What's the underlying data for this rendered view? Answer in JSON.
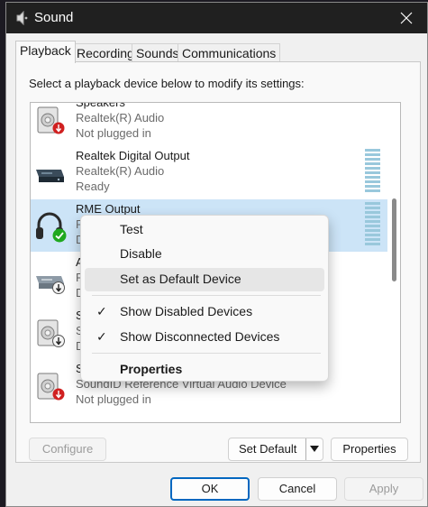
{
  "window": {
    "title": "Sound"
  },
  "tabs": [
    {
      "label": "Playback",
      "active": true
    },
    {
      "label": "Recording"
    },
    {
      "label": "Sounds"
    },
    {
      "label": "Communications"
    }
  ],
  "instruction": "Select a playback device below to modify its settings:",
  "devices": [
    {
      "name": "Speakers",
      "sub": "Realtek(R) Audio",
      "status": "Not plugged in",
      "icon": "speaker-icon",
      "badge": "unplugged-badge-icon"
    },
    {
      "name": "Realtek Digital Output",
      "sub": "Realtek(R) Audio",
      "status": "Ready",
      "icon": "digital-output-icon"
    },
    {
      "name": "RME Output",
      "sub": "R",
      "status": "D",
      "icon": "headphones-icon",
      "badge": "default-check-badge-icon",
      "selected": true
    },
    {
      "name": "A",
      "sub": "R",
      "status": "D",
      "icon": "digital-output-icon",
      "badge": "disabled-badge-icon"
    },
    {
      "name": "S",
      "sub": "S",
      "status": "D",
      "icon": "speaker-icon",
      "badge": "disabled-badge-icon"
    },
    {
      "name": "S",
      "sub": "SoundID Reference Virtual Audio Device",
      "status": "Not plugged in",
      "icon": "speaker-icon",
      "badge": "unplugged-badge-icon"
    }
  ],
  "context_menu": {
    "items": [
      {
        "label": "Test"
      },
      {
        "label": "Disable"
      },
      {
        "label": "Set as Default Device",
        "highlighted": true
      },
      {
        "label": "Show Disabled Devices",
        "checked": true,
        "check_glyph": "✓"
      },
      {
        "label": "Show Disconnected Devices",
        "checked": true,
        "check_glyph": "✓"
      },
      {
        "label": "Properties",
        "bold": true
      }
    ]
  },
  "buttons": {
    "configure": "Configure",
    "set_default": "Set Default",
    "properties": "Properties",
    "ok": "OK",
    "cancel": "Cancel",
    "apply": "Apply"
  },
  "colors": {
    "titlebar": "#202020",
    "selection": "#cce4f7",
    "accent": "#0067c0",
    "level_meter": "#99c8dc",
    "default_badge": "#1fa81f",
    "unplugged_badge": "#d02020"
  }
}
